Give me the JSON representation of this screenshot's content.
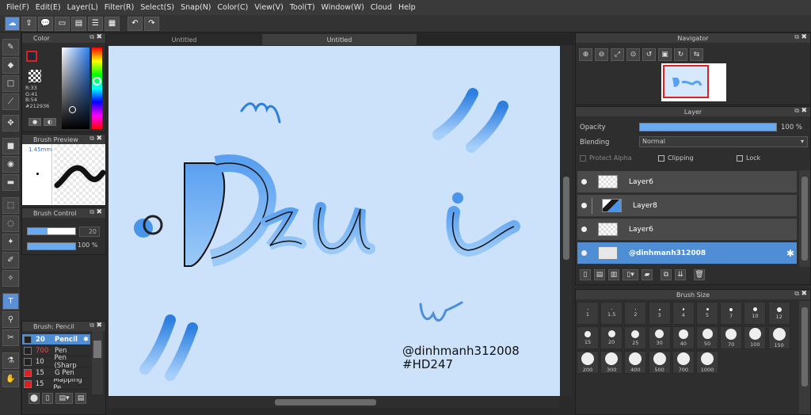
{
  "menu": [
    "File(F)",
    "Edit(E)",
    "Layer(L)",
    "Filter(R)",
    "Select(S)",
    "Snap(N)",
    "Color(C)",
    "View(V)",
    "Tool(T)",
    "Window(W)",
    "Cloud",
    "Help"
  ],
  "tabs": [
    "Untitled",
    "Untitled"
  ],
  "color_panel": {
    "title": "Color",
    "r": "R:33",
    "g": "G:41",
    "b": "B:54",
    "hex": "#212936"
  },
  "brush_preview": {
    "title": "Brush Preview",
    "size": "1.45mm"
  },
  "brush_control": {
    "title": "Brush Control",
    "size_value": "20",
    "opacity_value": "100 %"
  },
  "brush_list": {
    "title": "Brush: Pencil",
    "items": [
      {
        "size": "20",
        "name": "Pencil",
        "color": "#222222"
      },
      {
        "size": "700",
        "name": "Pen",
        "color": "#222222"
      },
      {
        "size": "10",
        "name": "Pen (Sharp",
        "color": "#222222"
      },
      {
        "size": "15",
        "name": "G Pen",
        "color": "#e02020"
      },
      {
        "size": "15",
        "name": "Mapping Pe",
        "color": "#e02020"
      }
    ]
  },
  "navigator": {
    "title": "Navigator"
  },
  "layer_panel": {
    "title": "Layer",
    "opacity_label": "Opacity",
    "opacity_value": "100 %",
    "blending_label": "Blending",
    "blending_value": "Normal",
    "protect_alpha": "Protect Alpha",
    "clipping": "Clipping",
    "lock": "Lock",
    "layers": [
      {
        "name": "Layer6"
      },
      {
        "name": "Layer8"
      },
      {
        "name": "Layer6"
      },
      {
        "name": "@dinhmanh312008"
      }
    ]
  },
  "brush_size": {
    "title": "Brush Size",
    "row1": [
      "1",
      "1.5",
      "2",
      "3",
      "4",
      "5",
      "7",
      "10",
      "12"
    ],
    "row2": [
      "15",
      "20",
      "25",
      "30",
      "40",
      "50",
      "70",
      "100",
      "150"
    ],
    "row3": [
      "200",
      "300",
      "400",
      "500",
      "700",
      "1000"
    ]
  },
  "artwork": {
    "main_text": "Dzui",
    "signature": "@dinhmanh312008",
    "hashtag": "#HD247"
  },
  "colors": {
    "accent": "#4f8ed4",
    "canvas_bg": "#cce2fa",
    "art_blue": "#4a94ec"
  }
}
